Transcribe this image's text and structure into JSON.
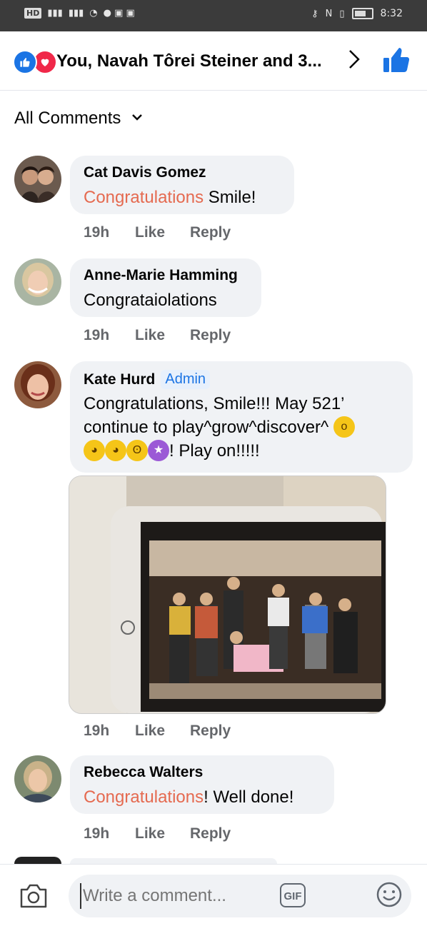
{
  "status_bar": {
    "left_chip": "HD",
    "signal_1": "46",
    "signal_2": "46",
    "time": "8:32"
  },
  "reactions": {
    "summary": "You, Navah Tôrei Steiner and 3...",
    "like_color": "#1b74e4",
    "love_color": "#f02849"
  },
  "filter": {
    "label": "All Comments"
  },
  "comments": [
    {
      "author": "Cat Davis Gomez",
      "highlight": "Congratulations",
      "text_after": " Smile!",
      "time": "19h",
      "like": "Like",
      "reply": "Reply"
    },
    {
      "author": "Anne-Marie Hamming",
      "text": "Congrataiolations",
      "time": "19h",
      "like": "Like",
      "reply": "Reply"
    },
    {
      "author": "Kate Hurd",
      "badge": "Admin",
      "line1": "Congratulations, Smile!!! May 521’",
      "line2": "continue to play^grow^discover^",
      "line3_end": "! Play on!!!!!",
      "time": "19h",
      "like": "Like",
      "reply": "Reply"
    },
    {
      "author": "Rebecca Walters",
      "highlight": "Congratulations",
      "text_after": "! Well done!",
      "time": "19h",
      "like": "Like",
      "reply": "Reply"
    }
  ],
  "composer": {
    "placeholder": "Write a comment...",
    "gif_label": "GIF"
  },
  "colors": {
    "highlight": "#e56a50",
    "bubble": "#f0f2f5",
    "meta": "#65676b"
  }
}
